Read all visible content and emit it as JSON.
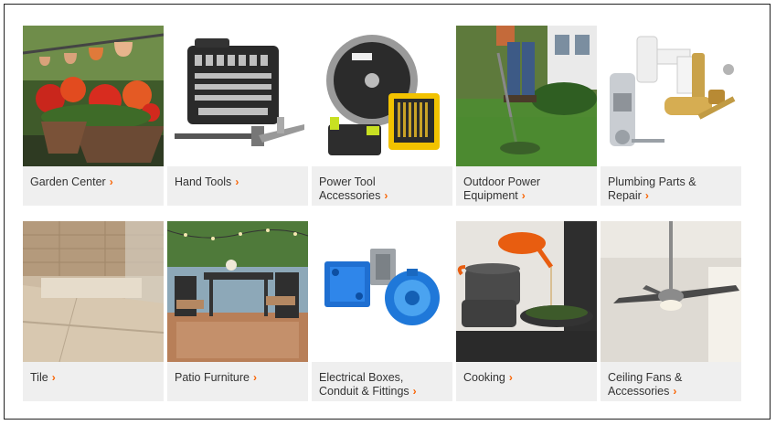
{
  "colors": {
    "accent": "#f96302",
    "label_bg": "#efefef",
    "label_text": "#333333"
  },
  "chevron_icon": "chevron-right-icon",
  "categories": [
    {
      "label": "Garden Center",
      "chevron": "›"
    },
    {
      "label": "Hand Tools",
      "chevron": "›"
    },
    {
      "label": "Power Tool Accessories",
      "chevron": "›"
    },
    {
      "label": "Outdoor Power Equipment",
      "chevron": "›"
    },
    {
      "label": "Plumbing Parts & Repair",
      "chevron": "›"
    },
    {
      "label": "Tile",
      "chevron": "›"
    },
    {
      "label": "Patio Furniture",
      "chevron": "›"
    },
    {
      "label": "Electrical Boxes, Conduit & Fittings",
      "chevron": "›"
    },
    {
      "label": "Cooking",
      "chevron": "›"
    },
    {
      "label": "Ceiling Fans & Accessories",
      "chevron": "›"
    }
  ]
}
